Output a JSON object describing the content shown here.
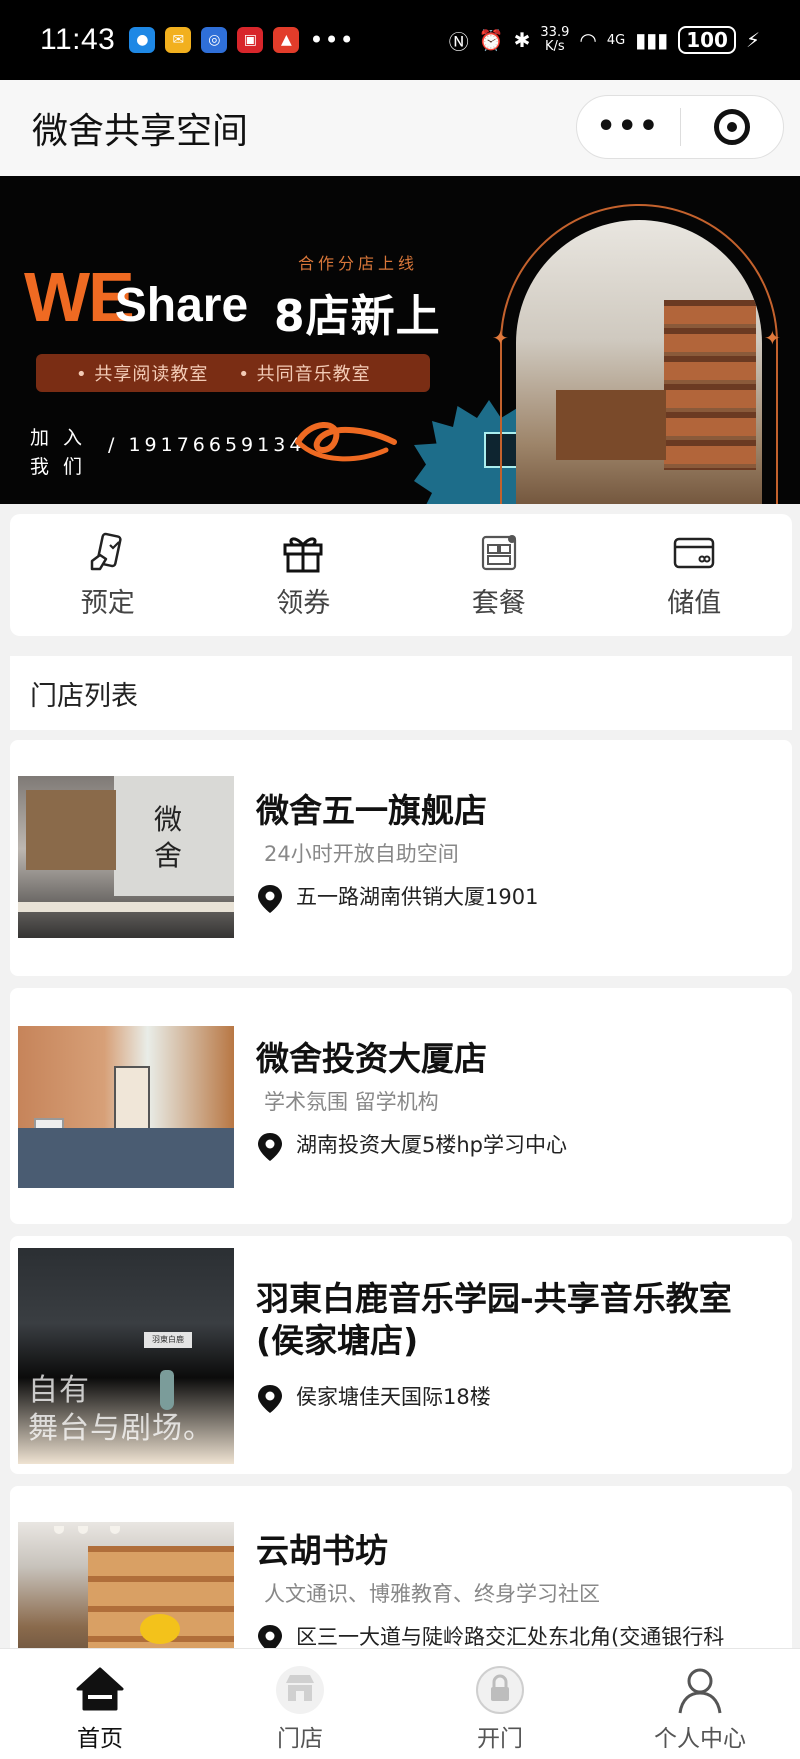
{
  "status_bar": {
    "time": "11:43",
    "dots": "•••",
    "speed_top": "33.9",
    "speed_bottom": "K/s",
    "network": "4G",
    "battery": "100"
  },
  "header": {
    "title": "微舍共享空间"
  },
  "banner": {
    "subtitle": "合作分店上线",
    "brand_we": "WE",
    "brand_share": "Share",
    "headline": "8店新上",
    "pill_item_1": "• 共享阅读教室",
    "pill_item_2": "• 共同音乐教室",
    "join_line_1": "加 入",
    "join_line_2": "我 们",
    "phone": "/ 19176659134"
  },
  "quick_actions": [
    {
      "label": "预定",
      "icon": "phone-booking-icon"
    },
    {
      "label": "领券",
      "icon": "gift-icon"
    },
    {
      "label": "套餐",
      "icon": "package-icon"
    },
    {
      "label": "储值",
      "icon": "card-icon"
    }
  ],
  "store_list": {
    "title": "门店列表",
    "stores": [
      {
        "name": "微舍五一旗舰店",
        "tag": "24小时开放自助空间",
        "address": "五一路湖南供销大厦1901",
        "image_logo": "微\n舍"
      },
      {
        "name": "微舍投资大厦店",
        "tag": "学术氛围 留学机构",
        "address": "湖南投资大厦5楼hp学习中心"
      },
      {
        "name": "羽東白鹿音乐学园-共享音乐教室(侯家塘店)",
        "tag": "",
        "address": "侯家塘佳天国际18楼",
        "image_sign": "羽東白鹿",
        "image_overlay_1": "自有",
        "image_overlay_2": "舞台与剧场。"
      },
      {
        "name": "云胡书坊",
        "tag": "人文通识、博雅教育、终身学习社区",
        "address": "区三一大道与陡岭路交汇处东北角(交通银行科"
      }
    ]
  },
  "tab_bar": [
    {
      "label": "首页",
      "icon": "home-icon",
      "active": true
    },
    {
      "label": "门店",
      "icon": "store-icon",
      "active": false
    },
    {
      "label": "开门",
      "icon": "unlock-icon",
      "active": false
    },
    {
      "label": "个人中心",
      "icon": "user-icon",
      "active": false
    }
  ],
  "colors": {
    "brand_orange": "#ef6a22",
    "banner_bg": "#050505",
    "pill_bg": "#7a2d14"
  }
}
